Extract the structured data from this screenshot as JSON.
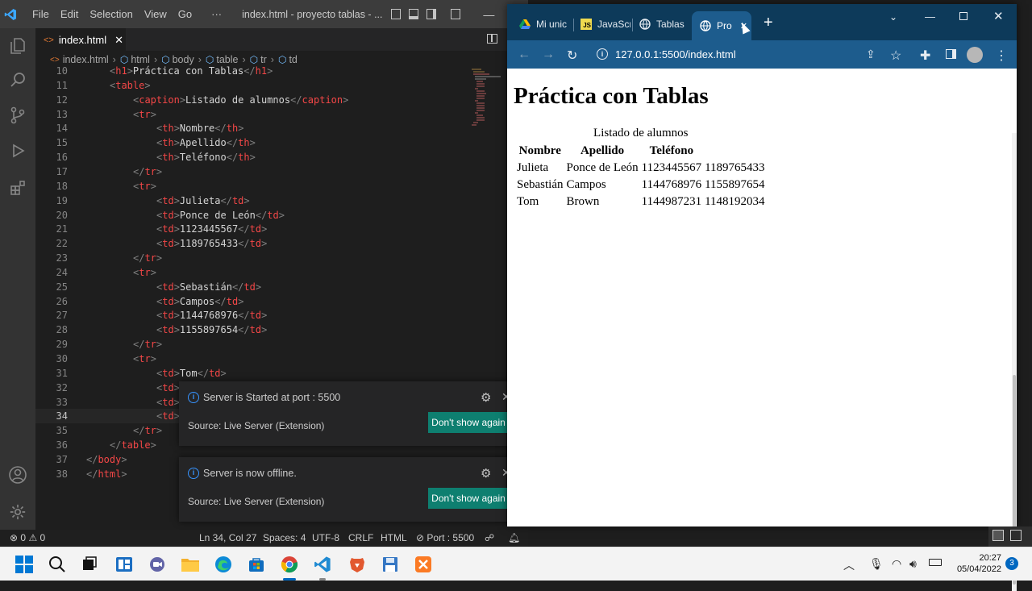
{
  "vscode": {
    "menu": [
      "File",
      "Edit",
      "Selection",
      "View",
      "Go",
      "···"
    ],
    "window_title": "index.html - proyecto tablas - ...",
    "tab": {
      "label": "index.html",
      "close": "✕"
    },
    "breadcrumb": [
      "index.html",
      "html",
      "body",
      "table",
      "tr",
      "td"
    ],
    "code_lines": [
      {
        "n": "10",
        "i": 1,
        "parts": [
          [
            "<",
            "tg"
          ],
          [
            "h1",
            "tn"
          ],
          [
            ">",
            "tg"
          ],
          [
            "Práctica con Tablas",
            "tx"
          ],
          [
            "</",
            "tg"
          ],
          [
            "h1",
            "tn"
          ],
          [
            ">",
            "tg"
          ]
        ]
      },
      {
        "n": "11",
        "i": 1,
        "parts": [
          [
            "<",
            "tg"
          ],
          [
            "table",
            "tn"
          ],
          [
            ">",
            "tg"
          ]
        ]
      },
      {
        "n": "12",
        "i": 2,
        "parts": [
          [
            "<",
            "tg"
          ],
          [
            "caption",
            "tn"
          ],
          [
            ">",
            "tg"
          ],
          [
            "Listado de alumnos",
            "tx"
          ],
          [
            "</",
            "tg"
          ],
          [
            "caption",
            "tn"
          ],
          [
            ">",
            "tg"
          ]
        ]
      },
      {
        "n": "13",
        "i": 2,
        "parts": [
          [
            "<",
            "tg"
          ],
          [
            "tr",
            "tn"
          ],
          [
            ">",
            "tg"
          ]
        ]
      },
      {
        "n": "14",
        "i": 3,
        "parts": [
          [
            "<",
            "tg"
          ],
          [
            "th",
            "tn"
          ],
          [
            ">",
            "tg"
          ],
          [
            "Nombre",
            "tx"
          ],
          [
            "</",
            "tg"
          ],
          [
            "th",
            "tn"
          ],
          [
            ">",
            "tg"
          ]
        ]
      },
      {
        "n": "15",
        "i": 3,
        "parts": [
          [
            "<",
            "tg"
          ],
          [
            "th",
            "tn"
          ],
          [
            ">",
            "tg"
          ],
          [
            "Apellido",
            "tx"
          ],
          [
            "</",
            "tg"
          ],
          [
            "th",
            "tn"
          ],
          [
            ">",
            "tg"
          ]
        ]
      },
      {
        "n": "16",
        "i": 3,
        "parts": [
          [
            "<",
            "tg"
          ],
          [
            "th",
            "tn"
          ],
          [
            ">",
            "tg"
          ],
          [
            "Teléfono",
            "tx"
          ],
          [
            "</",
            "tg"
          ],
          [
            "th",
            "tn"
          ],
          [
            ">",
            "tg"
          ]
        ]
      },
      {
        "n": "17",
        "i": 2,
        "parts": [
          [
            "</",
            "tg"
          ],
          [
            "tr",
            "tn"
          ],
          [
            ">",
            "tg"
          ]
        ]
      },
      {
        "n": "18",
        "i": 2,
        "parts": [
          [
            "<",
            "tg"
          ],
          [
            "tr",
            "tn"
          ],
          [
            ">",
            "tg"
          ]
        ]
      },
      {
        "n": "19",
        "i": 3,
        "parts": [
          [
            "<",
            "tg"
          ],
          [
            "td",
            "tn"
          ],
          [
            ">",
            "tg"
          ],
          [
            "Julieta",
            "tx"
          ],
          [
            "</",
            "tg"
          ],
          [
            "td",
            "tn"
          ],
          [
            ">",
            "tg"
          ]
        ]
      },
      {
        "n": "20",
        "i": 3,
        "parts": [
          [
            "<",
            "tg"
          ],
          [
            "td",
            "tn"
          ],
          [
            ">",
            "tg"
          ],
          [
            "Ponce de León",
            "tx"
          ],
          [
            "</",
            "tg"
          ],
          [
            "td",
            "tn"
          ],
          [
            ">",
            "tg"
          ]
        ]
      },
      {
        "n": "21",
        "i": 3,
        "parts": [
          [
            "<",
            "tg"
          ],
          [
            "td",
            "tn"
          ],
          [
            ">",
            "tg"
          ],
          [
            "1123445567",
            "tx"
          ],
          [
            "</",
            "tg"
          ],
          [
            "td",
            "tn"
          ],
          [
            ">",
            "tg"
          ]
        ]
      },
      {
        "n": "22",
        "i": 3,
        "parts": [
          [
            "<",
            "tg"
          ],
          [
            "td",
            "tn"
          ],
          [
            ">",
            "tg"
          ],
          [
            "1189765433",
            "tx"
          ],
          [
            "</",
            "tg"
          ],
          [
            "td",
            "tn"
          ],
          [
            ">",
            "tg"
          ]
        ]
      },
      {
        "n": "23",
        "i": 2,
        "parts": [
          [
            "</",
            "tg"
          ],
          [
            "tr",
            "tn"
          ],
          [
            ">",
            "tg"
          ]
        ]
      },
      {
        "n": "24",
        "i": 2,
        "parts": [
          [
            "<",
            "tg"
          ],
          [
            "tr",
            "tn"
          ],
          [
            ">",
            "tg"
          ]
        ]
      },
      {
        "n": "25",
        "i": 3,
        "parts": [
          [
            "<",
            "tg"
          ],
          [
            "td",
            "tn"
          ],
          [
            ">",
            "tg"
          ],
          [
            "Sebastián",
            "tx"
          ],
          [
            "</",
            "tg"
          ],
          [
            "td",
            "tn"
          ],
          [
            ">",
            "tg"
          ]
        ]
      },
      {
        "n": "26",
        "i": 3,
        "parts": [
          [
            "<",
            "tg"
          ],
          [
            "td",
            "tn"
          ],
          [
            ">",
            "tg"
          ],
          [
            "Campos",
            "tx"
          ],
          [
            "</",
            "tg"
          ],
          [
            "td",
            "tn"
          ],
          [
            ">",
            "tg"
          ]
        ]
      },
      {
        "n": "27",
        "i": 3,
        "parts": [
          [
            "<",
            "tg"
          ],
          [
            "td",
            "tn"
          ],
          [
            ">",
            "tg"
          ],
          [
            "1144768976",
            "tx"
          ],
          [
            "</",
            "tg"
          ],
          [
            "td",
            "tn"
          ],
          [
            ">",
            "tg"
          ]
        ]
      },
      {
        "n": "28",
        "i": 3,
        "parts": [
          [
            "<",
            "tg"
          ],
          [
            "td",
            "tn"
          ],
          [
            ">",
            "tg"
          ],
          [
            "1155897654",
            "tx"
          ],
          [
            "</",
            "tg"
          ],
          [
            "td",
            "tn"
          ],
          [
            ">",
            "tg"
          ]
        ]
      },
      {
        "n": "29",
        "i": 2,
        "parts": [
          [
            "</",
            "tg"
          ],
          [
            "tr",
            "tn"
          ],
          [
            ">",
            "tg"
          ]
        ]
      },
      {
        "n": "30",
        "i": 2,
        "parts": [
          [
            "<",
            "tg"
          ],
          [
            "tr",
            "tn"
          ],
          [
            ">",
            "tg"
          ]
        ]
      },
      {
        "n": "31",
        "i": 3,
        "parts": [
          [
            "<",
            "tg"
          ],
          [
            "td",
            "tn"
          ],
          [
            ">",
            "tg"
          ],
          [
            "Tom",
            "tx"
          ],
          [
            "</",
            "tg"
          ],
          [
            "td",
            "tn"
          ],
          [
            ">",
            "tg"
          ]
        ]
      },
      {
        "n": "32",
        "i": 3,
        "parts": [
          [
            "<",
            "tg"
          ],
          [
            "td",
            "tn"
          ],
          [
            ">",
            "tg"
          ]
        ]
      },
      {
        "n": "33",
        "i": 3,
        "parts": [
          [
            "<",
            "tg"
          ],
          [
            "td",
            "tn"
          ],
          [
            ">",
            "tg"
          ]
        ]
      },
      {
        "n": "34",
        "i": 3,
        "parts": [
          [
            "<",
            "tg"
          ],
          [
            "td",
            "tn"
          ],
          [
            ">",
            "tg"
          ]
        ],
        "current": true
      },
      {
        "n": "35",
        "i": 2,
        "parts": [
          [
            "</",
            "tg"
          ],
          [
            "tr",
            "tn"
          ],
          [
            ">",
            "tg"
          ]
        ]
      },
      {
        "n": "36",
        "i": 1,
        "parts": [
          [
            "</",
            "tg"
          ],
          [
            "table",
            "tn"
          ],
          [
            ">",
            "tg"
          ]
        ]
      },
      {
        "n": "37",
        "i": 0,
        "parts": [
          [
            "</",
            "tg"
          ],
          [
            "body",
            "tn"
          ],
          [
            ">",
            "tg"
          ]
        ]
      },
      {
        "n": "38",
        "i": 0,
        "parts": [
          [
            "</",
            "tg"
          ],
          [
            "html",
            "tn"
          ],
          [
            ">",
            "tg"
          ]
        ]
      }
    ],
    "notifications": [
      {
        "message": "Server is Started at port : 5500",
        "source": "Source: Live Server (Extension)",
        "button": "Don't show again"
      },
      {
        "message": "Server is now offline.",
        "source": "Source: Live Server (Extension)",
        "button": "Don't show again"
      }
    ],
    "statusbar": {
      "errors": "0",
      "warnings": "0",
      "position": "Ln 34, Col 27",
      "spaces": "Spaces: 4",
      "encoding": "UTF-8",
      "eol": "CRLF",
      "language": "HTML",
      "port": "Port : 5500"
    }
  },
  "chrome": {
    "tabs": [
      {
        "label": "Mi unic",
        "icon": "drive-icon"
      },
      {
        "label": "JavaScr",
        "icon": "js-icon"
      },
      {
        "label": "Tablas",
        "icon": "globe-icon"
      },
      {
        "label": "Pro",
        "icon": "globe-icon",
        "active": true
      }
    ],
    "new_tab": "+",
    "url": "127.0.0.1:5500/index.html",
    "page": {
      "heading": "Práctica con Tablas",
      "caption": "Listado de alumnos",
      "headers": [
        "Nombre",
        "Apellido",
        "Teléfono"
      ],
      "rows": [
        [
          "Julieta",
          "Ponce de León",
          "1123445567",
          "1189765433"
        ],
        [
          "Sebastián",
          "Campos",
          "1144768976",
          "1155897654"
        ],
        [
          "Tom",
          "Brown",
          "1144987231",
          "1148192034"
        ]
      ]
    }
  },
  "taskbar": {
    "time": "20:27",
    "date": "05/04/2022",
    "notification_count": "3"
  },
  "colors": {
    "vscode_bg": "#1e1e1e",
    "chrome_frame": "#0d3a5a",
    "chrome_toolbar": "#1d5c8d",
    "notif_button": "#0e7f70",
    "tag_name": "#f44747"
  }
}
